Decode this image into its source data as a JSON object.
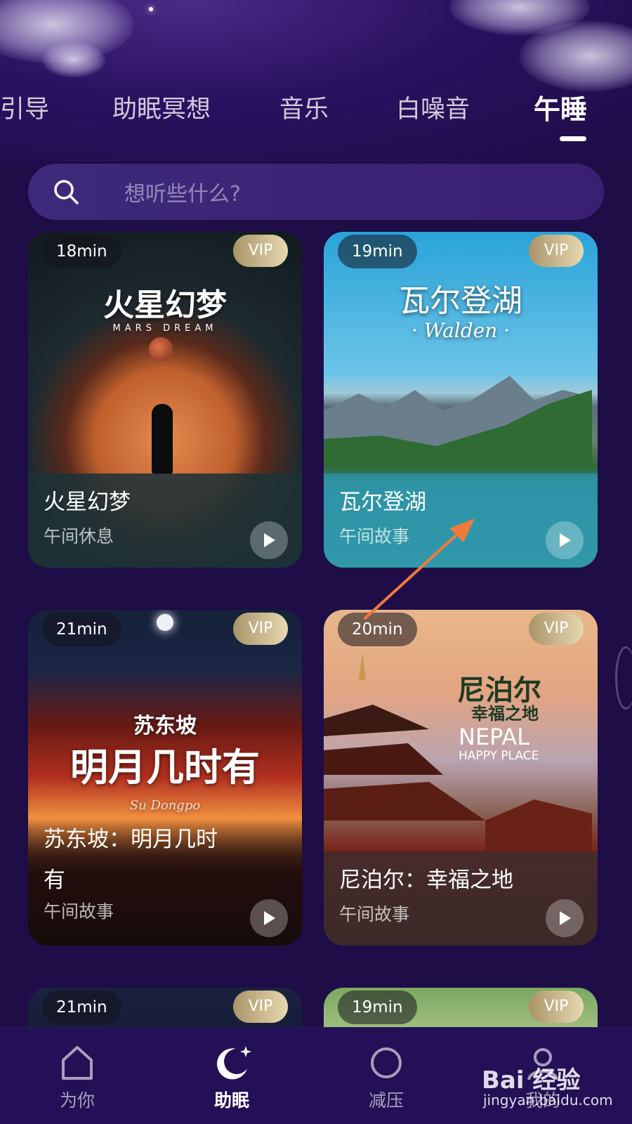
{
  "tabs": [
    {
      "label": "引导",
      "active": false
    },
    {
      "label": "助眠冥想",
      "active": false
    },
    {
      "label": "音乐",
      "active": false
    },
    {
      "label": "白噪音",
      "active": false
    },
    {
      "label": "午睡",
      "active": true
    }
  ],
  "search": {
    "placeholder": "想听些什么?"
  },
  "cards": [
    {
      "duration": "18min",
      "vip": "VIP",
      "title": "火星幻梦",
      "category": "午间休息",
      "art_title": "火星幻梦",
      "art_subtitle": "MARS DREAM"
    },
    {
      "duration": "19min",
      "vip": "VIP",
      "title": "瓦尔登湖",
      "category": "午间故事",
      "art_title": "瓦尔登湖",
      "art_subtitle": "· Walden ·"
    },
    {
      "duration": "21min",
      "vip": "VIP",
      "title_line1": "苏东坡：明月几时",
      "title_line2": "有",
      "category": "午间故事",
      "art_title_top": "苏东坡",
      "art_title": "明月几时有",
      "art_subtitle": "Su Dongpo"
    },
    {
      "duration": "20min",
      "vip": "VIP",
      "title": "尼泊尔：幸福之地",
      "category": "午间故事",
      "art_title_top": "尼泊尔",
      "art_title_mid": "幸福之地",
      "art_title_en": "NEPAL",
      "art_title_en2": "HAPPY PLACE"
    },
    {
      "duration": "21min",
      "vip": "VIP"
    },
    {
      "duration": "19min",
      "vip": "VIP"
    }
  ],
  "bottom_nav": [
    {
      "label": "为你",
      "icon": "home-icon",
      "active": false
    },
    {
      "label": "助眠",
      "icon": "moon-icon",
      "active": true
    },
    {
      "label": "减压",
      "icon": "circle-icon",
      "active": false
    },
    {
      "label": "我的",
      "icon": "profile-icon",
      "active": false
    }
  ],
  "watermark": {
    "text": "Bai 经验",
    "url_text": "jingyan.baidu.com"
  },
  "colors": {
    "background": "#1e0d47",
    "vip_gold": "#c9b88c",
    "arrow": "#f07a3c"
  }
}
